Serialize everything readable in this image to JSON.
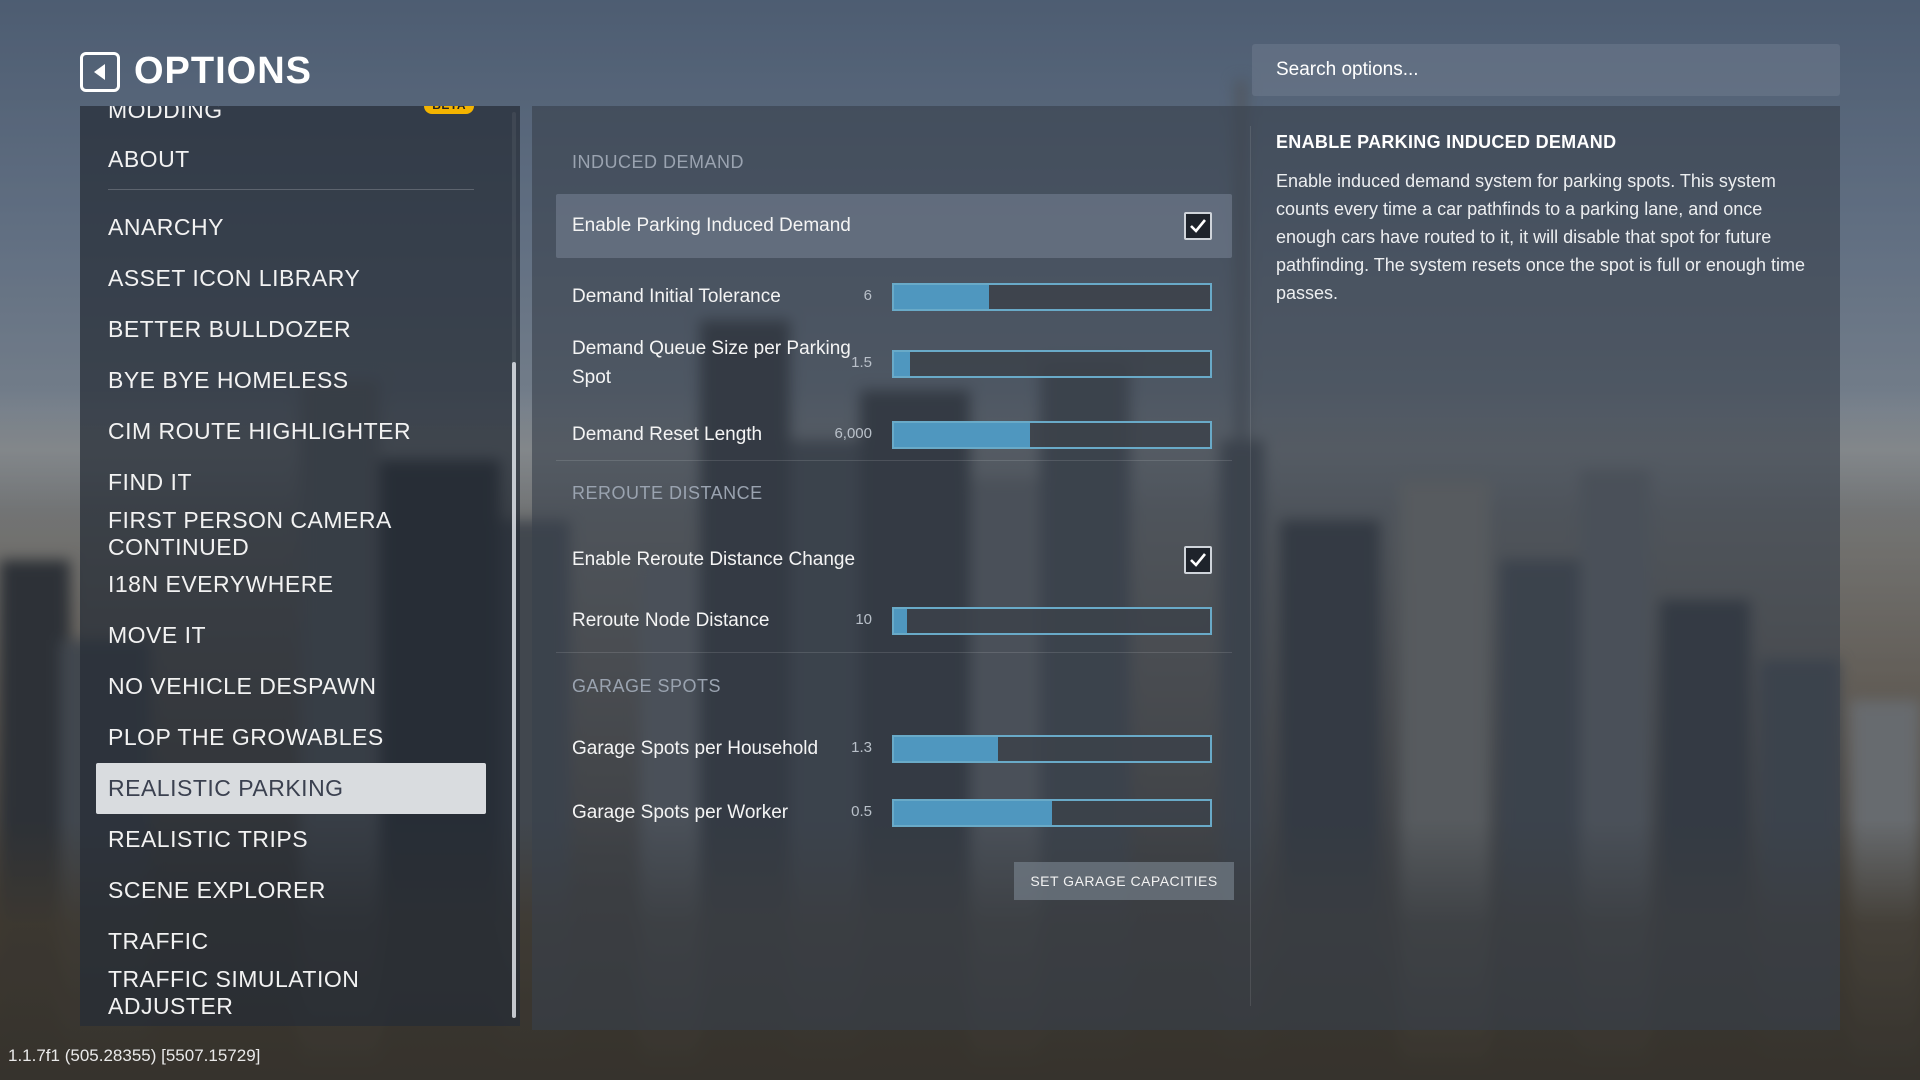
{
  "header": {
    "title": "OPTIONS"
  },
  "search": {
    "placeholder": "Search options..."
  },
  "sidebar": {
    "partial_top": {
      "label": "MODDING",
      "badge": "BETA"
    },
    "items": [
      {
        "label": "ABOUT"
      },
      {
        "label": "ANARCHY"
      },
      {
        "label": "ASSET ICON LIBRARY"
      },
      {
        "label": "BETTER BULLDOZER"
      },
      {
        "label": "BYE BYE HOMELESS"
      },
      {
        "label": "CIM ROUTE HIGHLIGHTER"
      },
      {
        "label": "FIND IT"
      },
      {
        "label": "FIRST PERSON CAMERA CONTINUED"
      },
      {
        "label": "I18N EVERYWHERE"
      },
      {
        "label": "MOVE IT"
      },
      {
        "label": "NO VEHICLE DESPAWN"
      },
      {
        "label": "PLOP THE GROWABLES"
      },
      {
        "label": "REALISTIC PARKING",
        "active": true
      },
      {
        "label": "REALISTIC TRIPS"
      },
      {
        "label": "SCENE EXPLORER"
      },
      {
        "label": "TRAFFIC"
      },
      {
        "label": "TRAFFIC SIMULATION ADJUSTER"
      }
    ]
  },
  "settings": {
    "induced_demand": {
      "title": "INDUCED DEMAND",
      "enable": {
        "label": "Enable Parking Induced Demand",
        "checked": true
      },
      "tolerance": {
        "label": "Demand Initial Tolerance",
        "value": "6",
        "fill": 0.3
      },
      "queue": {
        "label_line1": "Demand Queue Size per Parking",
        "label_line2": "Spot",
        "value": "1.5",
        "fill": 0.05
      },
      "reset": {
        "label": "Demand Reset Length",
        "value": "6,000",
        "fill": 0.43
      }
    },
    "reroute": {
      "title": "REROUTE DISTANCE",
      "enable": {
        "label": "Enable Reroute Distance Change",
        "checked": true
      },
      "node": {
        "label": "Reroute Node Distance",
        "value": "10",
        "fill": 0.04
      }
    },
    "garage": {
      "title": "GARAGE SPOTS",
      "household": {
        "label": "Garage Spots per Household",
        "value": "1.3",
        "fill": 0.33
      },
      "worker": {
        "label": "Garage Spots per Worker",
        "value": "0.5",
        "fill": 0.5
      },
      "button": "SET GARAGE CAPACITIES"
    }
  },
  "description": {
    "title": "ENABLE PARKING INDUCED DEMAND",
    "text": "Enable induced demand system for parking spots. This system counts every time a car pathfinds to a parking lane, and once enough cars have routed to it, it will disable that spot for future pathfinding. The system resets once the spot is full or enough time passes."
  },
  "version": "1.1.7f1 (505.28355) [5507.15729]",
  "colors": {
    "accent": "#4f97bf",
    "beta_badge": "#f4b400",
    "active_item_bg": "#d9dcdf"
  }
}
